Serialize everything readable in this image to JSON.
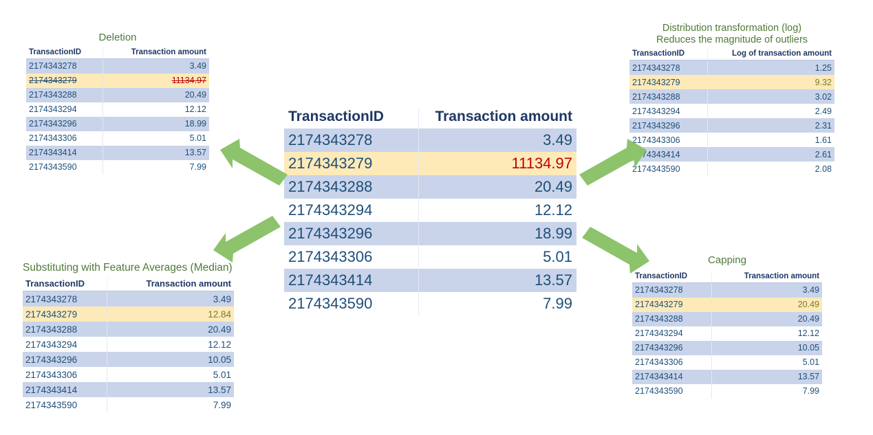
{
  "theme": {
    "background": "#ffffff",
    "title_color": "#4E7A38",
    "header_color": "#1F3864",
    "cell_color": "#1F4E79",
    "band_color": "#C9D4EA",
    "highlight_color": "#FDEAB8",
    "outlier_color": "#C00000",
    "arrow_color": "#8CC36B"
  },
  "main_table": {
    "columns": [
      "TransactionID",
      "Transaction amount"
    ],
    "rows": [
      {
        "id": "2174343278",
        "amount": "3.49",
        "band": true,
        "highlight": false,
        "outlier": false
      },
      {
        "id": "2174343279",
        "amount": "11134.97",
        "band": false,
        "highlight": true,
        "outlier": true
      },
      {
        "id": "2174343288",
        "amount": "20.49",
        "band": true,
        "highlight": false,
        "outlier": false
      },
      {
        "id": "2174343294",
        "amount": "12.12",
        "band": false,
        "highlight": false,
        "outlier": false
      },
      {
        "id": "2174343296",
        "amount": "18.99",
        "band": true,
        "highlight": false,
        "outlier": false
      },
      {
        "id": "2174343306",
        "amount": "5.01",
        "band": false,
        "highlight": false,
        "outlier": false
      },
      {
        "id": "2174343414",
        "amount": "13.57",
        "band": true,
        "highlight": false,
        "outlier": false
      },
      {
        "id": "2174343590",
        "amount": "7.99",
        "band": false,
        "highlight": false,
        "outlier": false
      }
    ]
  },
  "deletion": {
    "title": "Deletion",
    "columns": [
      "TransactionID",
      "Transaction amount"
    ],
    "rows": [
      {
        "id": "2174343278",
        "amount": "3.49",
        "band": true,
        "highlight": false,
        "outlier": false,
        "strike": false
      },
      {
        "id": "2174343279",
        "amount": "11134.97",
        "band": false,
        "highlight": true,
        "outlier": true,
        "strike": true
      },
      {
        "id": "2174343288",
        "amount": "20.49",
        "band": true,
        "highlight": false,
        "outlier": false,
        "strike": false
      },
      {
        "id": "2174343294",
        "amount": "12.12",
        "band": false,
        "highlight": false,
        "outlier": false,
        "strike": false
      },
      {
        "id": "2174343296",
        "amount": "18.99",
        "band": true,
        "highlight": false,
        "outlier": false,
        "strike": false
      },
      {
        "id": "2174343306",
        "amount": "5.01",
        "band": false,
        "highlight": false,
        "outlier": false,
        "strike": false
      },
      {
        "id": "2174343414",
        "amount": "13.57",
        "band": true,
        "highlight": false,
        "outlier": false,
        "strike": false
      },
      {
        "id": "2174343590",
        "amount": "7.99",
        "band": false,
        "highlight": false,
        "outlier": false,
        "strike": false
      }
    ]
  },
  "log_transform": {
    "title": "Distribution transformation (log)\nReduces the magnitude of outliers",
    "columns": [
      "TransactionID",
      "Log of transaction amount"
    ],
    "rows": [
      {
        "id": "2174343278",
        "amount": "1.25",
        "band": true,
        "highlight": false,
        "olive": false
      },
      {
        "id": "2174343279",
        "amount": "9.32",
        "band": false,
        "highlight": true,
        "olive": true
      },
      {
        "id": "2174343288",
        "amount": "3.02",
        "band": true,
        "highlight": false,
        "olive": false
      },
      {
        "id": "2174343294",
        "amount": "2.49",
        "band": false,
        "highlight": false,
        "olive": false
      },
      {
        "id": "2174343296",
        "amount": "2.31",
        "band": true,
        "highlight": false,
        "olive": false
      },
      {
        "id": "2174343306",
        "amount": "1.61",
        "band": false,
        "highlight": false,
        "olive": false
      },
      {
        "id": "2174343414",
        "amount": "2.61",
        "band": true,
        "highlight": false,
        "olive": false
      },
      {
        "id": "2174343590",
        "amount": "2.08",
        "band": false,
        "highlight": false,
        "olive": false
      }
    ]
  },
  "median_substitution": {
    "title": "Substituting with Feature Averages (Median)",
    "columns": [
      "TransactionID",
      "Transaction amount"
    ],
    "rows": [
      {
        "id": "2174343278",
        "amount": "3.49",
        "band": true,
        "highlight": false,
        "olive": false
      },
      {
        "id": "2174343279",
        "amount": "12.84",
        "band": false,
        "highlight": true,
        "olive": true
      },
      {
        "id": "2174343288",
        "amount": "20.49",
        "band": true,
        "highlight": false,
        "olive": false
      },
      {
        "id": "2174343294",
        "amount": "12.12",
        "band": false,
        "highlight": false,
        "olive": false
      },
      {
        "id": "2174343296",
        "amount": "10.05",
        "band": true,
        "highlight": false,
        "olive": false
      },
      {
        "id": "2174343306",
        "amount": "5.01",
        "band": false,
        "highlight": false,
        "olive": false
      },
      {
        "id": "2174343414",
        "amount": "13.57",
        "band": true,
        "highlight": false,
        "olive": false
      },
      {
        "id": "2174343590",
        "amount": "7.99",
        "band": false,
        "highlight": false,
        "olive": false
      }
    ]
  },
  "capping": {
    "title": "Capping",
    "columns": [
      "TransactionID",
      "Transaction amount"
    ],
    "rows": [
      {
        "id": "2174343278",
        "amount": "3.49",
        "band": true,
        "highlight": false,
        "olive": false
      },
      {
        "id": "2174343279",
        "amount": "20.49",
        "band": false,
        "highlight": true,
        "olive": true
      },
      {
        "id": "2174343288",
        "amount": "20.49",
        "band": true,
        "highlight": false,
        "olive": false
      },
      {
        "id": "2174343294",
        "amount": "12.12",
        "band": false,
        "highlight": false,
        "olive": false
      },
      {
        "id": "2174343296",
        "amount": "10.05",
        "band": true,
        "highlight": false,
        "olive": false
      },
      {
        "id": "2174343306",
        "amount": "5.01",
        "band": false,
        "highlight": false,
        "olive": false
      },
      {
        "id": "2174343414",
        "amount": "13.57",
        "band": true,
        "highlight": false,
        "olive": false
      },
      {
        "id": "2174343590",
        "amount": "7.99",
        "band": false,
        "highlight": false,
        "olive": false
      }
    ]
  },
  "arrows": [
    {
      "name": "arrow-to-deletion",
      "direction": "up-left"
    },
    {
      "name": "arrow-to-median",
      "direction": "down-left"
    },
    {
      "name": "arrow-to-logtransform",
      "direction": "up-right"
    },
    {
      "name": "arrow-to-capping",
      "direction": "down-right"
    }
  ]
}
